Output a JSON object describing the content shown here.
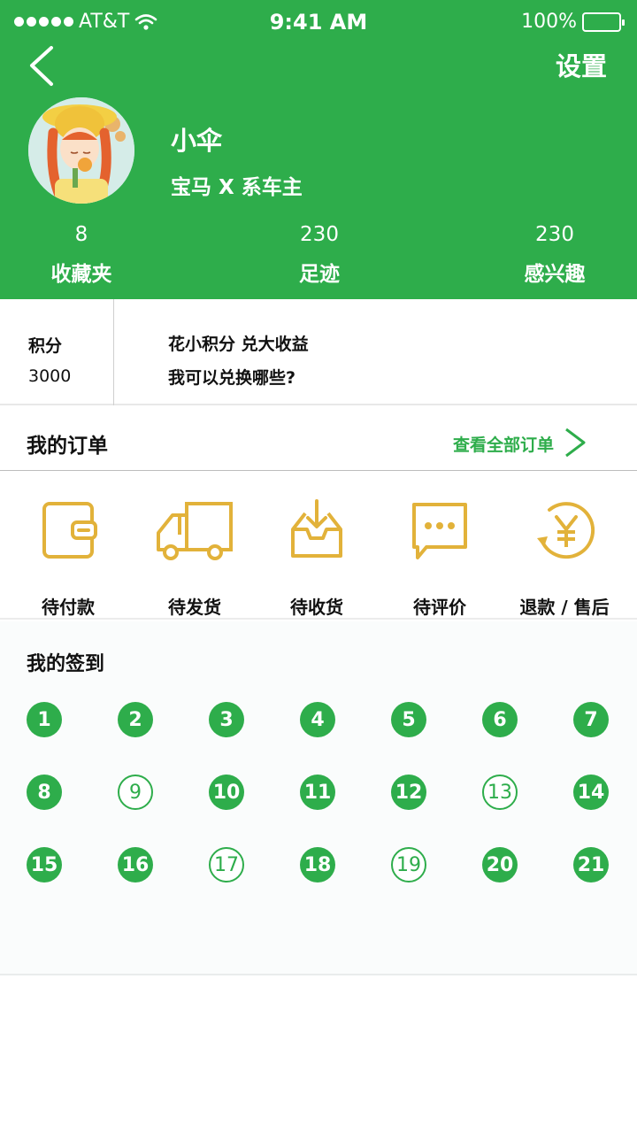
{
  "colors": {
    "brand_green": "#2ead4b",
    "icon_gold": "#e2b23a"
  },
  "status_bar": {
    "carrier": "AT&T",
    "time": "9:41 AM",
    "battery": "100%"
  },
  "nav": {
    "back_icon": "chevron-left-icon",
    "settings_label": "设置"
  },
  "profile": {
    "name": "小伞",
    "subtitle": "宝马 X 系车主"
  },
  "stats": [
    {
      "value": "8",
      "label": "收藏夹"
    },
    {
      "value": "230",
      "label": "足迹"
    },
    {
      "value": "230",
      "label": "感兴趣"
    }
  ],
  "points": {
    "label": "积分",
    "value": "3000",
    "promo_line1": "花小积分  兑大收益",
    "promo_line2": "我可以兑换哪些?"
  },
  "orders": {
    "title": "我的订单",
    "view_all": "查看全部订单",
    "items": [
      {
        "label": "待付款",
        "icon": "wallet-icon"
      },
      {
        "label": "待发货",
        "icon": "truck-icon"
      },
      {
        "label": "待收货",
        "icon": "inbox-download-icon"
      },
      {
        "label": "待评价",
        "icon": "chat-bubble-icon"
      },
      {
        "label": "退款 / 售后",
        "icon": "yen-refund-icon"
      }
    ]
  },
  "signin": {
    "title": "我的签到",
    "days": [
      {
        "day": "1",
        "checked": true
      },
      {
        "day": "2",
        "checked": true
      },
      {
        "day": "3",
        "checked": true
      },
      {
        "day": "4",
        "checked": true
      },
      {
        "day": "5",
        "checked": true
      },
      {
        "day": "6",
        "checked": true
      },
      {
        "day": "7",
        "checked": true
      },
      {
        "day": "8",
        "checked": true
      },
      {
        "day": "9",
        "checked": false
      },
      {
        "day": "10",
        "checked": true
      },
      {
        "day": "11",
        "checked": true
      },
      {
        "day": "12",
        "checked": true
      },
      {
        "day": "13",
        "checked": false
      },
      {
        "day": "14",
        "checked": true
      },
      {
        "day": "15",
        "checked": true
      },
      {
        "day": "16",
        "checked": true
      },
      {
        "day": "17",
        "checked": false
      },
      {
        "day": "18",
        "checked": true
      },
      {
        "day": "19",
        "checked": false
      },
      {
        "day": "20",
        "checked": true
      },
      {
        "day": "21",
        "checked": true
      }
    ]
  }
}
